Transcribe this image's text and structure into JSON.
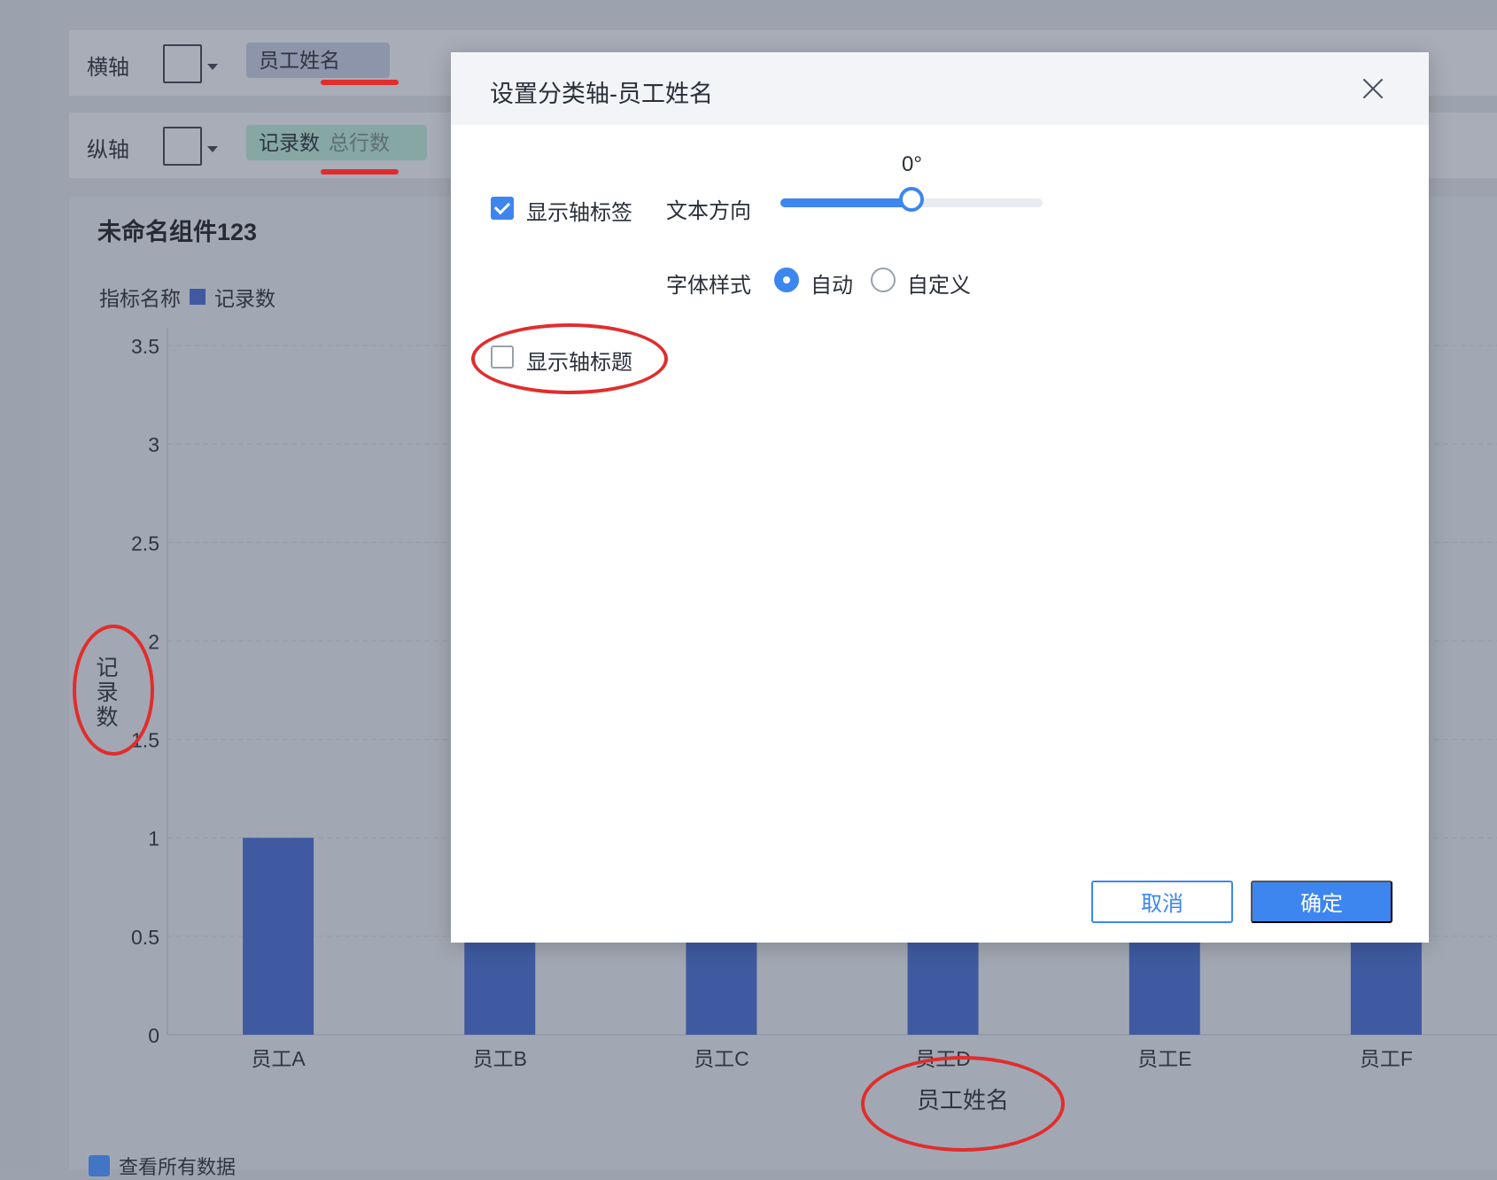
{
  "toolbar": {
    "x_axis_label": "横轴",
    "x_field": "员工姓名",
    "y_axis_label": "纵轴",
    "y_field": "记录数",
    "y_field_sub": "总行数"
  },
  "chart": {
    "title": "未命名组件123",
    "legend_title": "指标名称",
    "legend_item": "记录数",
    "y_title": "记录数",
    "x_title": "员工姓名",
    "bottom_checkbox": "查看所有数据"
  },
  "chart_data": {
    "type": "bar",
    "categories": [
      "员工A",
      "员工B",
      "员工C",
      "员工D",
      "员工E",
      "员工F"
    ],
    "values": [
      1,
      1,
      1,
      1,
      1,
      2
    ],
    "xlabel": "员工姓名",
    "ylabel": "记录数",
    "ylim": [
      0,
      3.5
    ],
    "yticks": [
      "0",
      "0.5",
      "1",
      "1.5",
      "2",
      "2.5",
      "3",
      "3.5"
    ],
    "bar_color": "#3f5aa0"
  },
  "dialog": {
    "title": "设置分类轴-员工姓名",
    "show_axis_label": "显示轴标签",
    "show_axis_label_checked": true,
    "text_direction_label": "文本方向",
    "text_direction_value": "0°",
    "slider_fraction": 0.5,
    "font_style_label": "字体样式",
    "font_auto": "自动",
    "font_custom": "自定义",
    "show_axis_title": "显示轴标题",
    "show_axis_title_checked": false,
    "cancel": "取消",
    "ok": "确定"
  },
  "colors": {
    "accent": "#3d86f0",
    "annotation_red": "#e12d2d",
    "bar": "#3f5aa0"
  }
}
